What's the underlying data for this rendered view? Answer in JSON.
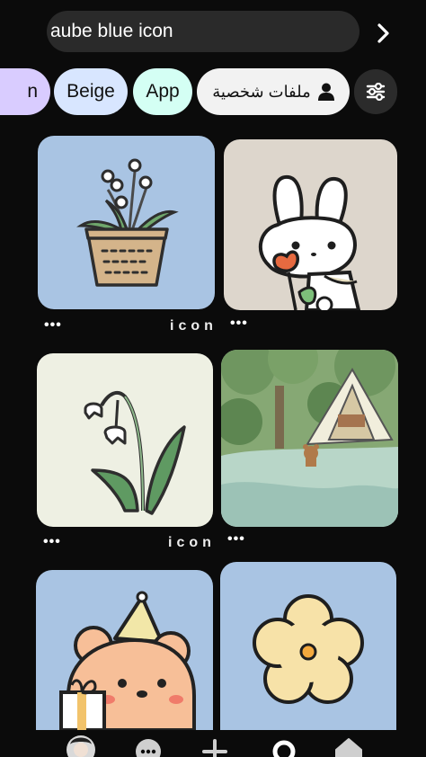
{
  "search": {
    "value": "aube blue icon",
    "go_icon": "chevron-right-icon"
  },
  "chips": [
    {
      "label": "n",
      "color": "#d9ccff"
    },
    {
      "label": "Beige",
      "color": "#d8e6ff"
    },
    {
      "label": "App",
      "color": "#d4fff4"
    },
    {
      "label": "ملفات شخصية",
      "icon": "person-icon",
      "color": "#f2f2f2"
    }
  ],
  "filter": {
    "icon": "sliders-icon"
  },
  "pins": [
    {
      "subject": "potted lily of the valley",
      "bg": "#a9c4e3",
      "more": "•••",
      "caption": "icon"
    },
    {
      "subject": "white bunny with tulip",
      "bg": "#ddd6cc",
      "more": "•••",
      "caption": ""
    },
    {
      "subject": "lily of the valley stem",
      "bg": "#eef0e3",
      "more": "•••",
      "caption": "icon"
    },
    {
      "subject": "bear camping by lake",
      "bg": "#a8c8b0",
      "more": "•••",
      "caption": ""
    },
    {
      "subject": "bear with party hat and gift",
      "bg": "#a9c4e3"
    },
    {
      "subject": "yellow flower",
      "bg": "#a9c4e3"
    }
  ],
  "bottom_nav": [
    {
      "name": "profile",
      "icon": "avatar-icon"
    },
    {
      "name": "messages",
      "icon": "chat-icon"
    },
    {
      "name": "create",
      "icon": "plus-icon"
    },
    {
      "name": "search",
      "icon": "search-icon"
    },
    {
      "name": "home",
      "icon": "home-icon"
    }
  ]
}
